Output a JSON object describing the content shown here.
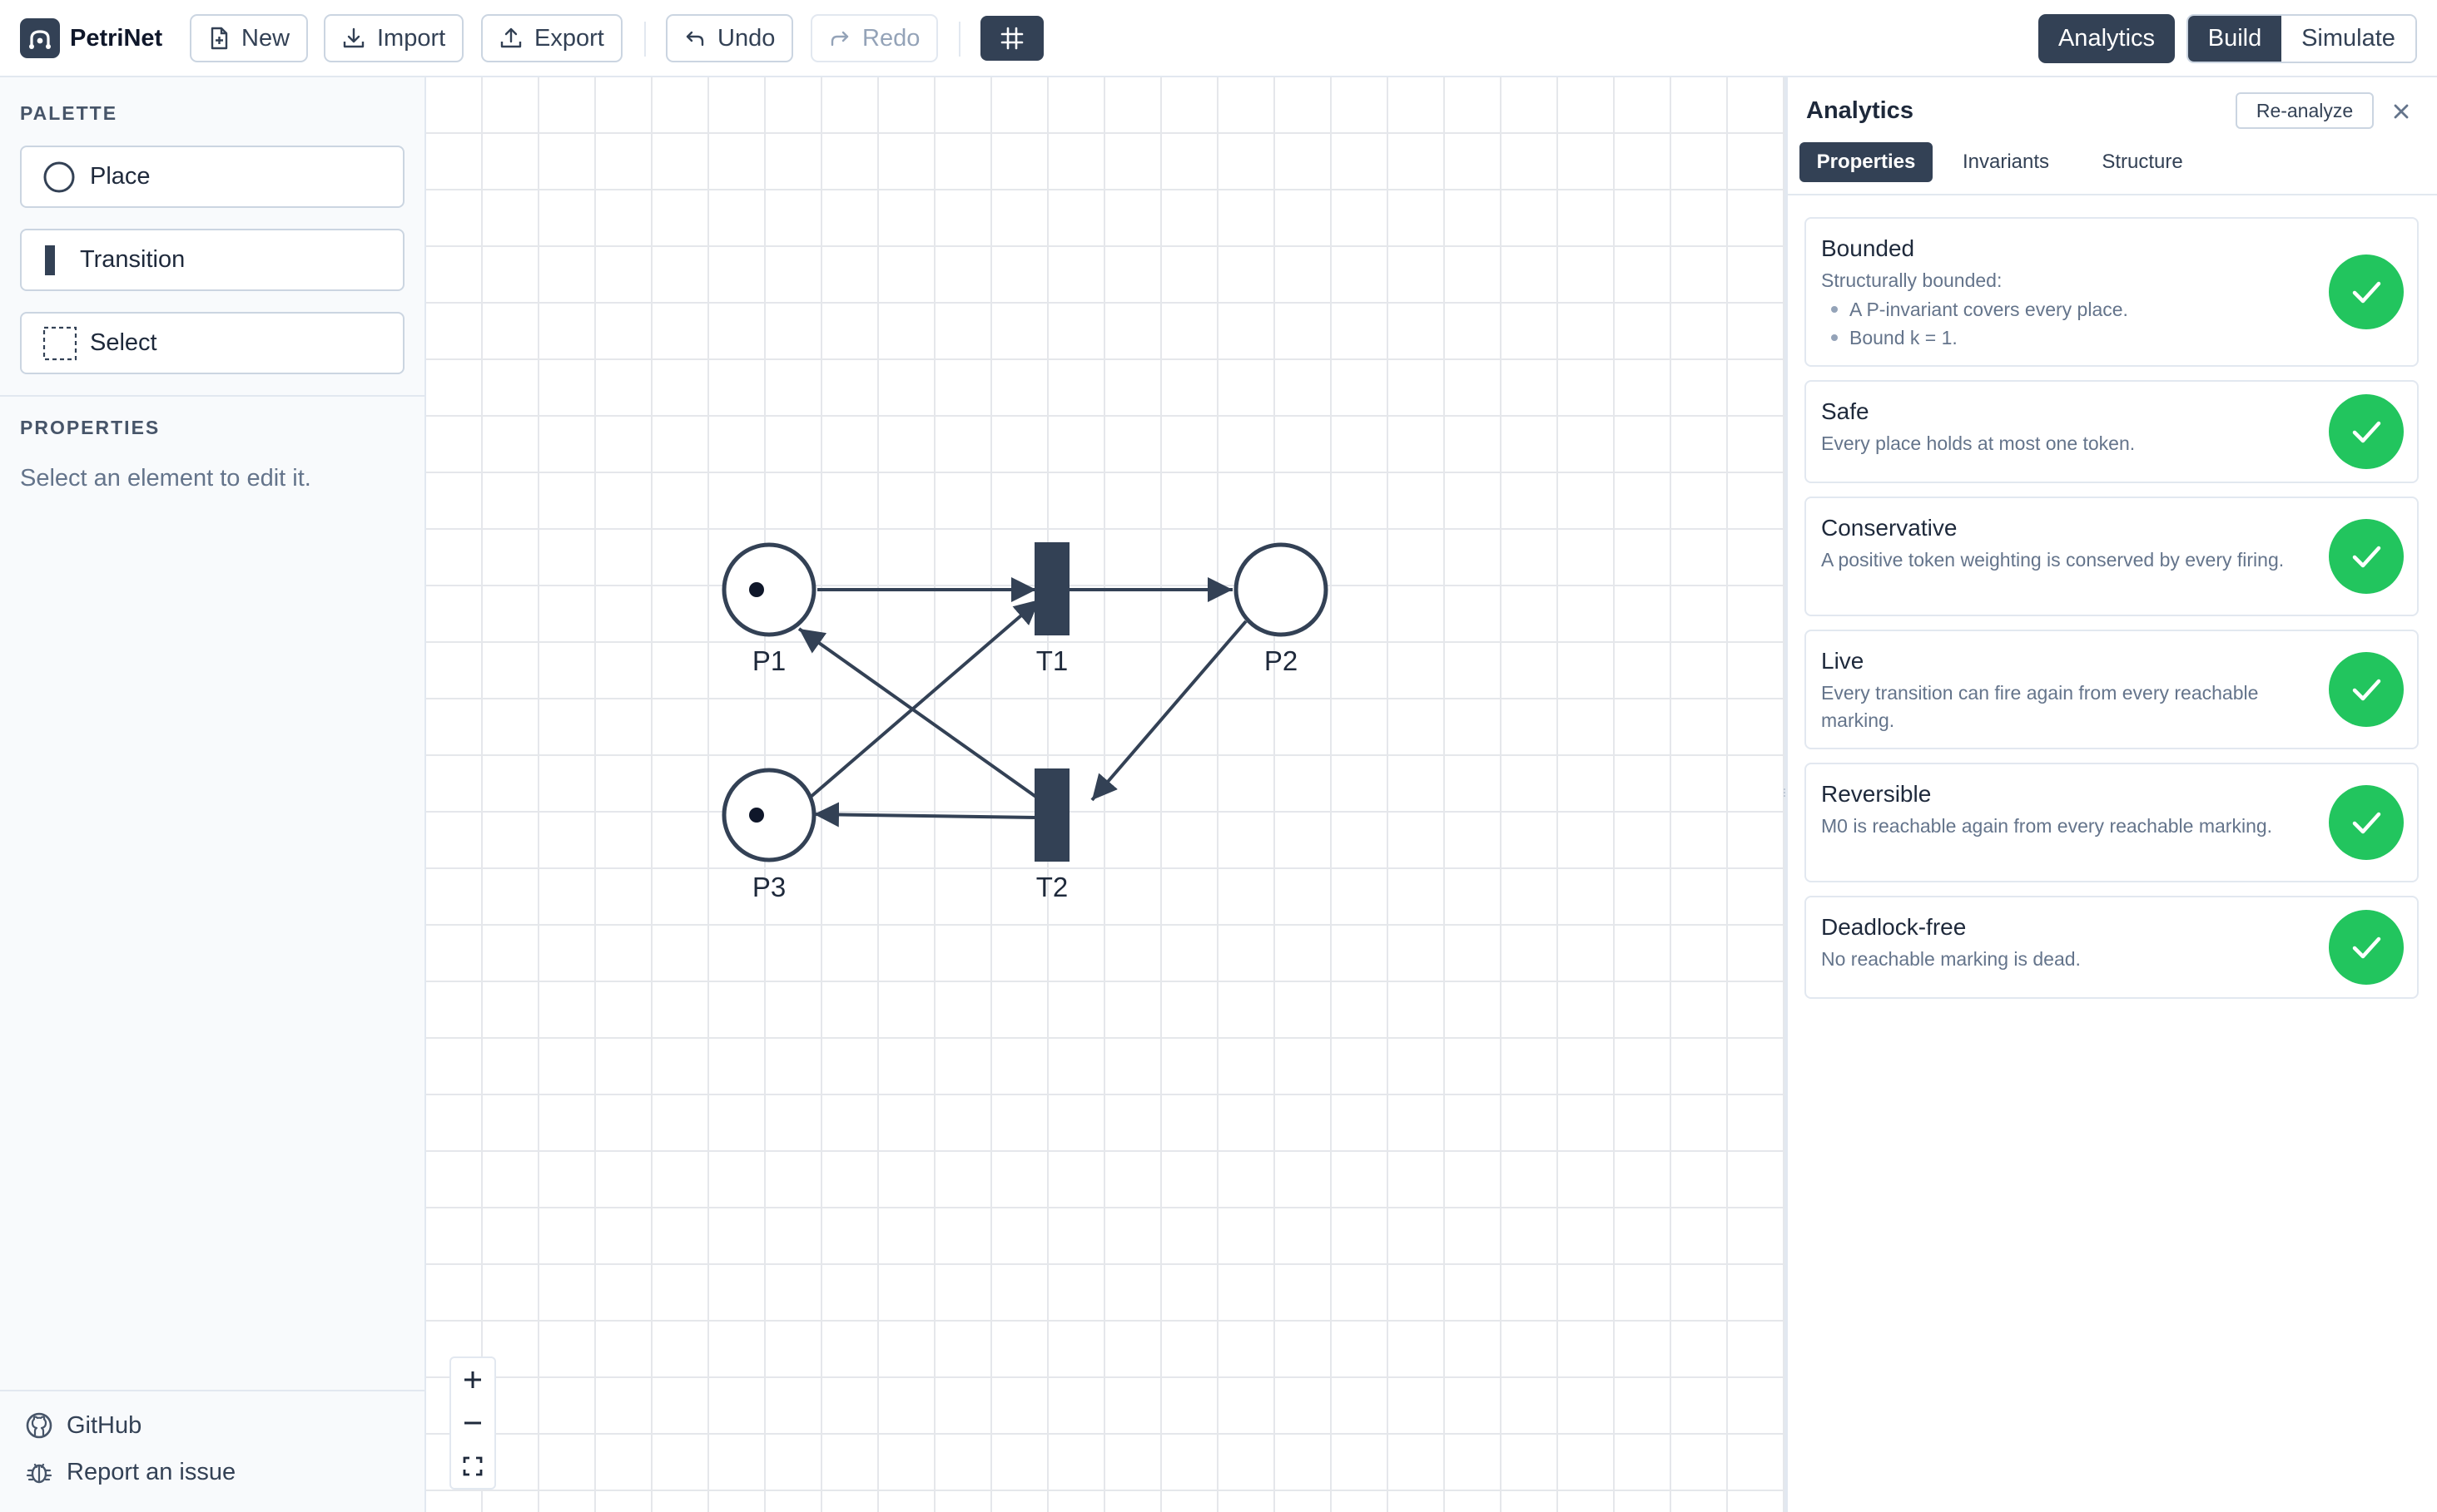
{
  "header": {
    "app_name": "PetriNet",
    "new_label": "New",
    "import_label": "Import",
    "export_label": "Export",
    "undo_label": "Undo",
    "redo_label": "Redo",
    "analytics_label": "Analytics",
    "mode_build": "Build",
    "mode_simulate": "Simulate",
    "active_mode": "Build"
  },
  "sidebar": {
    "palette_title": "PALETTE",
    "palette_items": [
      "Place",
      "Transition",
      "Select"
    ],
    "properties_title": "PROPERTIES",
    "properties_hint": "Select an element to edit it.",
    "footer_links": [
      "GitHub",
      "Report an issue"
    ]
  },
  "net": {
    "places": [
      {
        "label": "P1",
        "tokens": 1
      },
      {
        "label": "P2",
        "tokens": 0
      },
      {
        "label": "P3",
        "tokens": 1
      }
    ],
    "transitions": [
      {
        "label": "T1"
      },
      {
        "label": "T2"
      }
    ],
    "arcs": [
      {
        "from": "P1",
        "to": "T1"
      },
      {
        "from": "T1",
        "to": "P2"
      },
      {
        "from": "P3",
        "to": "T1"
      },
      {
        "from": "P2",
        "to": "T2"
      },
      {
        "from": "T2",
        "to": "P1"
      },
      {
        "from": "T2",
        "to": "P3"
      }
    ]
  },
  "analytics": {
    "title": "Analytics",
    "reanalyze_label": "Re-analyze",
    "tabs": [
      "Properties",
      "Invariants",
      "Structure"
    ],
    "active_tab": "Properties",
    "properties": [
      {
        "title": "Bounded",
        "description": "Structurally bounded:",
        "bullets": [
          "A P-invariant covers every place.",
          "Bound k = 1."
        ],
        "status": "pass"
      },
      {
        "title": "Safe",
        "description": "Every place holds at most one token.",
        "status": "pass"
      },
      {
        "title": "Conservative",
        "description": "A positive token weighting is conserved by every firing.",
        "status": "pass"
      },
      {
        "title": "Live",
        "description": "Every transition can fire again from every reachable marking.",
        "status": "pass"
      },
      {
        "title": "Reversible",
        "description": "M0 is reachable again from every reachable marking.",
        "status": "pass"
      },
      {
        "title": "Deadlock-free",
        "description": "No reachable marking is dead.",
        "status": "pass"
      }
    ]
  },
  "colors": {
    "primary": "#334155",
    "success": "#22c55e",
    "grid": "#e5e7eb",
    "muted_text": "#64748b"
  }
}
